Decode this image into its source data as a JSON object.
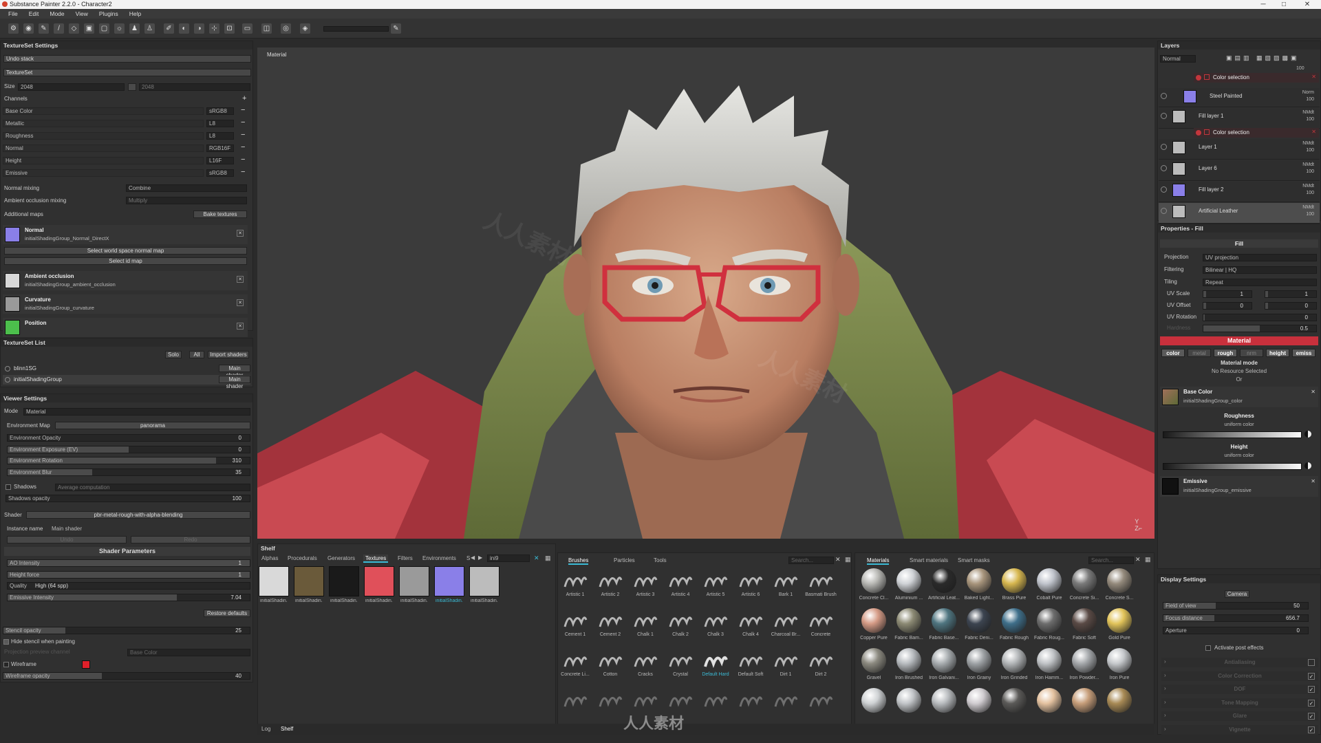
{
  "app": {
    "title": "Substance Painter 2.2.0 - Character2",
    "menu": [
      "File",
      "Edit",
      "Mode",
      "View",
      "Plugins",
      "Help"
    ]
  },
  "viewport": {
    "label": "Material"
  },
  "textureset_settings": {
    "title": "TextureSet Settings",
    "undo_stack": "Undo stack",
    "textureset": "TextureSet",
    "size_label": "Size",
    "size_value": "2048",
    "size_value2": "2048",
    "channels_label": "Channels",
    "channels": [
      {
        "name": "Base Color",
        "format": "sRGB8"
      },
      {
        "name": "Metallic",
        "format": "L8"
      },
      {
        "name": "Roughness",
        "format": "L8"
      },
      {
        "name": "Normal",
        "format": "RGB16F"
      },
      {
        "name": "Height",
        "format": "L16F"
      },
      {
        "name": "Emissive",
        "format": "sRGB8"
      }
    ],
    "normal_mixing_label": "Normal mixing",
    "normal_mixing_value": "Combine",
    "ao_mixing_label": "Ambient occlusion mixing",
    "ao_mixing_value": "Multiply",
    "additional_maps": "Additional maps",
    "bake_textures": "Bake textures",
    "maps": [
      {
        "name": "Normal",
        "file": "initialShadingGroup_Normal_DirectX",
        "color": "#8a7fe8"
      },
      {
        "name": "Ambient occlusion",
        "file": "initialShadingGroup_ambient_occlusion",
        "color": "#d8d8d8"
      },
      {
        "name": "Curvature",
        "file": "initialShadingGroup_curvature",
        "color": "#9a9a9a"
      },
      {
        "name": "Position",
        "file": "",
        "color": "#4cbf4c"
      }
    ],
    "select_normal_map": "Select world space normal map",
    "select_id_map": "Select id map"
  },
  "textureset_list": {
    "title": "TextureSet List",
    "solo": "Solo",
    "all": "All",
    "import_shaders": "Import shaders",
    "items": [
      {
        "name": "blinn1SG",
        "shader": "Main shader"
      },
      {
        "name": "initialShadingGroup",
        "shader": "Main shader"
      }
    ]
  },
  "viewer_settings": {
    "title": "Viewer Settings",
    "mode_label": "Mode",
    "mode_value": "Material",
    "env_map_label": "Environment Map",
    "env_map_value": "panorama",
    "sliders": [
      {
        "label": "Environment Opacity",
        "value": "0",
        "fill": 0.0
      },
      {
        "label": "Environment Exposure (EV)",
        "value": "0",
        "fill": 0.5
      },
      {
        "label": "Environment Rotation",
        "value": "310",
        "fill": 0.86
      },
      {
        "label": "Environment Blur",
        "value": "35",
        "fill": 0.35
      }
    ],
    "shadows_label": "Shadows",
    "shadows_value": "Average computation",
    "shadows_opacity_label": "Shadows opacity",
    "shadows_opacity_value": "100",
    "shader_label": "Shader",
    "shader_value": "pbr-metal-rough-with-alpha-blending",
    "instance_name_label": "Instance name",
    "instance_name_value": "Main shader",
    "undo": "Undo",
    "redo": "Redo",
    "shader_params_title": "Shader Parameters",
    "params": [
      {
        "label": "AO Intensity",
        "value": "1",
        "fill": 1.0
      },
      {
        "label": "Height force",
        "value": "1",
        "fill": 1.0
      },
      {
        "label": "Quality",
        "value": "High (64 spp)",
        "fill": 0.0
      },
      {
        "label": "Emissive Intensity",
        "value": "7.04",
        "fill": 0.7
      }
    ],
    "restore_defaults": "Restore defaults",
    "stencil_opacity_label": "Stencil opacity",
    "stencil_opacity_value": "25",
    "hide_stencil": "Hide stencil when painting",
    "projection_preview": "Projection preview channel",
    "projection_preview_value": "Base Color",
    "wireframe": "Wireframe",
    "wireframe_color": "#e0202a",
    "wireframe_opacity_label": "Wireframe opacity",
    "wireframe_opacity_value": "40"
  },
  "layers": {
    "title": "Layers",
    "blend": "Normal",
    "top_value": "100",
    "items": [
      {
        "name": "Color selection",
        "blend": "",
        "opacity": "",
        "mask": true,
        "color": "#c3363c"
      },
      {
        "name": "Steel Painted",
        "blend": "Norm",
        "opacity": "100",
        "color": "#8a7fe8"
      },
      {
        "name": "Fill layer 1",
        "blend": "NMdt",
        "opacity": "100",
        "color": "#bcbcbc"
      },
      {
        "name": "Color selection",
        "blend": "",
        "opacity": "",
        "mask": true,
        "color": "#c3363c"
      },
      {
        "name": "Layer 1",
        "blend": "NMdt",
        "opacity": "100",
        "color": "#bcbcbc"
      },
      {
        "name": "Layer 6",
        "blend": "NMdt",
        "opacity": "100",
        "color": "#bcbcbc"
      },
      {
        "name": "Fill layer 2",
        "blend": "NMdt",
        "opacity": "100",
        "color": "#8a7fe8"
      },
      {
        "name": "Artificial Leather",
        "blend": "NMdt",
        "opacity": "100",
        "color": "#bcbcbc"
      }
    ]
  },
  "properties": {
    "title": "Properties - Fill",
    "fill_header": "Fill",
    "projection_label": "Projection",
    "projection_value": "UV projection",
    "filtering_label": "Filtering",
    "filtering_value": "Bilinear | HQ",
    "tiling_label": "Tiling",
    "tiling_value": "Repeat",
    "uv_scale_label": "UV Scale",
    "uv_scale_value": "1",
    "uv_scale_value2": "1",
    "uv_offset_label": "UV Offset",
    "uv_offset_value": "0",
    "uv_offset_value2": "0",
    "uv_rotation_label": "UV Rotation",
    "uv_rotation_value": "0",
    "hardness_label": "Hardness",
    "hardness_value": "0.5",
    "material_header": "Material",
    "channel_chips": [
      "color",
      "metal",
      "rough",
      "nrm",
      "height",
      "emiss"
    ],
    "material_mode": "Material mode",
    "no_resource": "No Resource Selected",
    "or": "Or",
    "base_color_label": "Base Color",
    "base_color_file": "initialShadingGroup_color",
    "roughness_label": "Roughness",
    "roughness_sub": "uniform color",
    "height_label": "Height",
    "height_sub": "uniform color",
    "emissive_label": "Emissive",
    "emissive_file": "initialShadingGroup_emissive"
  },
  "display_settings": {
    "title": "Display Settings",
    "camera": "Camera",
    "fov_label": "Field of view",
    "fov_value": "50",
    "focus_label": "Focus distance",
    "focus_value": "656.7",
    "aperture_label": "Aperture",
    "aperture_value": "0",
    "post_effects": "Activate post effects",
    "sections": [
      "Antialiasing",
      "Color Correction",
      "DOF",
      "Tone Mapping",
      "Glare",
      "Vignette"
    ]
  },
  "shelf": {
    "title": "Shelf",
    "tabs": [
      "Alphas",
      "Procedurals",
      "Generators",
      "Textures",
      "Filters",
      "Environments",
      "S"
    ],
    "active_tab": "Textures",
    "search_value": "ini9",
    "textures": [
      {
        "label": "initialShadin...",
        "color": "#d9d9d9"
      },
      {
        "label": "initialShadin...",
        "color": "#6a5a3a"
      },
      {
        "label": "initialShadin...",
        "color": "#1a1a1a"
      },
      {
        "label": "initialShadin...",
        "color": "#e0505a"
      },
      {
        "label": "initialShadin...",
        "color": "#9a9a9a"
      },
      {
        "label": "initialShadin...",
        "color": "#8a7fe8"
      },
      {
        "label": "initialShadin...",
        "color": "#bcbcbc"
      }
    ],
    "brush_tabs": [
      "Brushes",
      "Particles",
      "Tools"
    ],
    "brush_search": "Search...",
    "brushes": [
      "Artistic 1",
      "Artistic 2",
      "Artistic 3",
      "Artistic 4",
      "Artistic 5",
      "Artistic 6",
      "Bark 1",
      "Basmati Brush",
      "Cement 1",
      "Cement 2",
      "Chalk 1",
      "Chalk 2",
      "Chalk 3",
      "Chalk 4",
      "Charcoal Br...",
      "Concrete",
      "Concrete Li...",
      "Cotton",
      "Cracks",
      "Crystal",
      "Default Hard",
      "Default Soft",
      "Dirt 1",
      "Dirt 2",
      "",
      "",
      "",
      "",
      "",
      "",
      "",
      ""
    ],
    "material_tabs": [
      "Materials",
      "Smart materials",
      "Smart masks"
    ],
    "material_search": "Search...",
    "materials": [
      {
        "label": "Concrete Cl...",
        "color": "#b9b9b5"
      },
      {
        "label": "Aluminium ...",
        "color": "#cfd2d6"
      },
      {
        "label": "Artificial Leat...",
        "color": "#2a2a2a"
      },
      {
        "label": "Baked Light...",
        "color": "#a8957c"
      },
      {
        "label": "Brass Pure",
        "color": "#d7b74f"
      },
      {
        "label": "Cobalt Pure",
        "color": "#c0c4cc"
      },
      {
        "label": "Concrete Si...",
        "color": "#7a7a7a"
      },
      {
        "label": "Concrete S...",
        "color": "#948a7c"
      },
      {
        "label": "Copper Pure",
        "color": "#d59b86"
      },
      {
        "label": "Fabric Bam...",
        "color": "#8c8a74"
      },
      {
        "label": "Fabric Base...",
        "color": "#4f7580"
      },
      {
        "label": "Fabric Deni...",
        "color": "#3c4450"
      },
      {
        "label": "Fabric Rough",
        "color": "#3f6f8a"
      },
      {
        "label": "Fabric Roug...",
        "color": "#6d6d6d"
      },
      {
        "label": "Fabric Soft",
        "color": "#5a4a45"
      },
      {
        "label": "Gold Pure",
        "color": "#e2c45a"
      },
      {
        "label": "Gravel",
        "color": "#8c8a80"
      },
      {
        "label": "Iron Brushed",
        "color": "#b8bcc0"
      },
      {
        "label": "Iron Galvani...",
        "color": "#a8adb0"
      },
      {
        "label": "Iron Grainy",
        "color": "#9fa3a6"
      },
      {
        "label": "Iron Grinded",
        "color": "#b3b6b8"
      },
      {
        "label": "Iron Hamm...",
        "color": "#c0c3c6"
      },
      {
        "label": "Iron Powder...",
        "color": "#a6a9ac"
      },
      {
        "label": "Iron Pure",
        "color": "#c6c9cc"
      },
      {
        "label": "",
        "color": "#cfd2d4"
      },
      {
        "label": "",
        "color": "#c2c5c8"
      },
      {
        "label": "",
        "color": "#b9bcbf"
      },
      {
        "label": "",
        "color": "#d0ccd0"
      },
      {
        "label": "",
        "color": "#5b5a58"
      },
      {
        "label": "",
        "color": "#e4c2a0"
      },
      {
        "label": "",
        "color": "#c79e7a"
      },
      {
        "label": "",
        "color": "#a88a55"
      }
    ]
  },
  "bottom_tabs": [
    "Log",
    "Shelf"
  ],
  "watermark": "人人素材"
}
